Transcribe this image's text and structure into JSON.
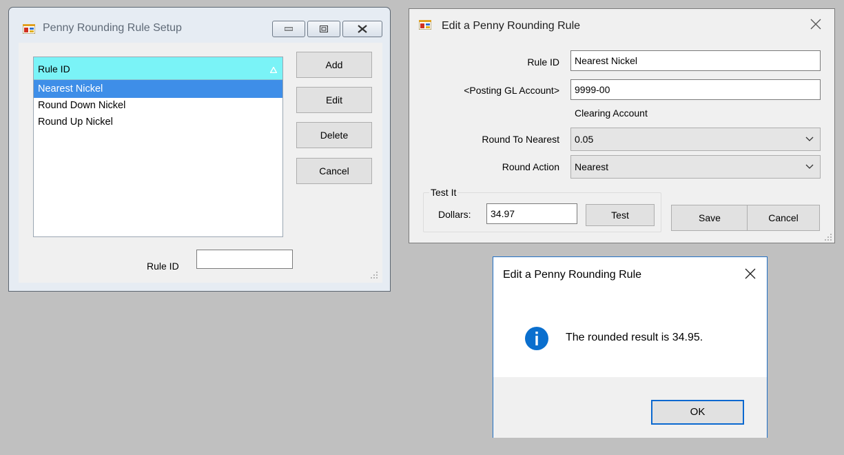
{
  "setup_window": {
    "title": "Penny Rounding Rule Setup",
    "icon": "app-form-icon",
    "list": {
      "header": "Rule ID",
      "sort_indicator": "sort-ascending-icon",
      "items": [
        "Nearest Nickel",
        "Round Down Nickel",
        "Round Up Nickel"
      ],
      "selected_index": 0
    },
    "buttons": {
      "add": "Add",
      "edit": "Edit",
      "delete": "Delete",
      "cancel": "Cancel"
    },
    "rule_id_label": "Rule ID",
    "rule_id_value": ""
  },
  "edit_window": {
    "title": "Edit a Penny Rounding Rule",
    "icon": "app-form-icon",
    "rule_id_label": "Rule ID",
    "rule_id_value": "Nearest Nickel",
    "gl_account_label": "<Posting GL Account>",
    "gl_account_value": "9999-00",
    "gl_account_description": "Clearing Account",
    "round_to_label": "Round To Nearest",
    "round_to_value": "0.05",
    "round_action_label": "Round Action",
    "round_action_value": "Nearest",
    "test_group": {
      "title": "Test It",
      "dollars_label": "Dollars:",
      "dollars_value": "34.97",
      "test_button": "Test"
    },
    "save_button": "Save",
    "cancel_button": "Cancel"
  },
  "message_box": {
    "title": "Edit a Penny Rounding Rule",
    "icon": "info-icon",
    "message": "The rounded result is 34.95.",
    "ok_button": "OK"
  },
  "colors": {
    "desktop": "#c0c0c0",
    "list_header": "#7af3f7",
    "selection": "#3e8ee8",
    "info_icon": "#0a6fce",
    "default_button_border": "#0a68d0"
  }
}
